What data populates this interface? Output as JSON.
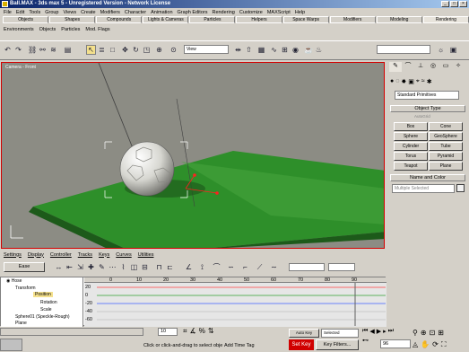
{
  "window": {
    "title": "Ball.MAX - 3ds max 5 - Unregistered Version - Network License",
    "min": "_",
    "max": "□",
    "close": "×"
  },
  "menu": [
    "File",
    "Edit",
    "Tools",
    "Group",
    "Views",
    "Create",
    "Modifiers",
    "Character",
    "Animation",
    "Graph Editors",
    "Rendering",
    "Customize",
    "MAXScript",
    "Help"
  ],
  "tabs": [
    "Objects",
    "Shapes",
    "Compounds",
    "Lights & Cameras",
    "Particles",
    "Helpers",
    "Space Warps",
    "Modifiers",
    "Modeling",
    "Rendering"
  ],
  "tab_toolbar": [
    "Environments",
    "Objects",
    "Particles",
    "Mod. Flags"
  ],
  "view_dropdown": "View",
  "viewport": {
    "label": "Camera - Front"
  },
  "command_panel": {
    "category": "Standard Primitives",
    "autogrid": "AutoGrid",
    "object_type": "Object Type",
    "buttons": [
      "Box",
      "Cone",
      "Sphere",
      "GeoSphere",
      "Cylinder",
      "Tube",
      "Torus",
      "Pyramid",
      "Teapot",
      "Plane"
    ],
    "name_color": "Name and Color",
    "name_value": "Multiple Selected"
  },
  "trackview": {
    "menu": [
      "Settings",
      "Display",
      "Controller",
      "Tracks",
      "Keys",
      "Curves",
      "Utilities"
    ],
    "filter": "Ease",
    "tree": [
      "Hose",
      "Transform",
      "Position",
      "Rotation",
      "Scale",
      "Sphere01 (Speckle-Rough)",
      "Plane"
    ],
    "ticks": [
      "0",
      "10",
      "20",
      "30",
      "40",
      "50",
      "60",
      "70",
      "80",
      "90"
    ],
    "rows": [
      "20",
      "0",
      "-20",
      "-40",
      "-60"
    ]
  },
  "status": {
    "frame": "10",
    "prompt": "Click or click-and-drag to select objects",
    "add_time_tag": "Add Time Tag",
    "auto_key": "Auto Key",
    "selected": "Selected",
    "set_key": "Set Key",
    "key_filters": "Key Filters...",
    "current_frame": "96"
  }
}
